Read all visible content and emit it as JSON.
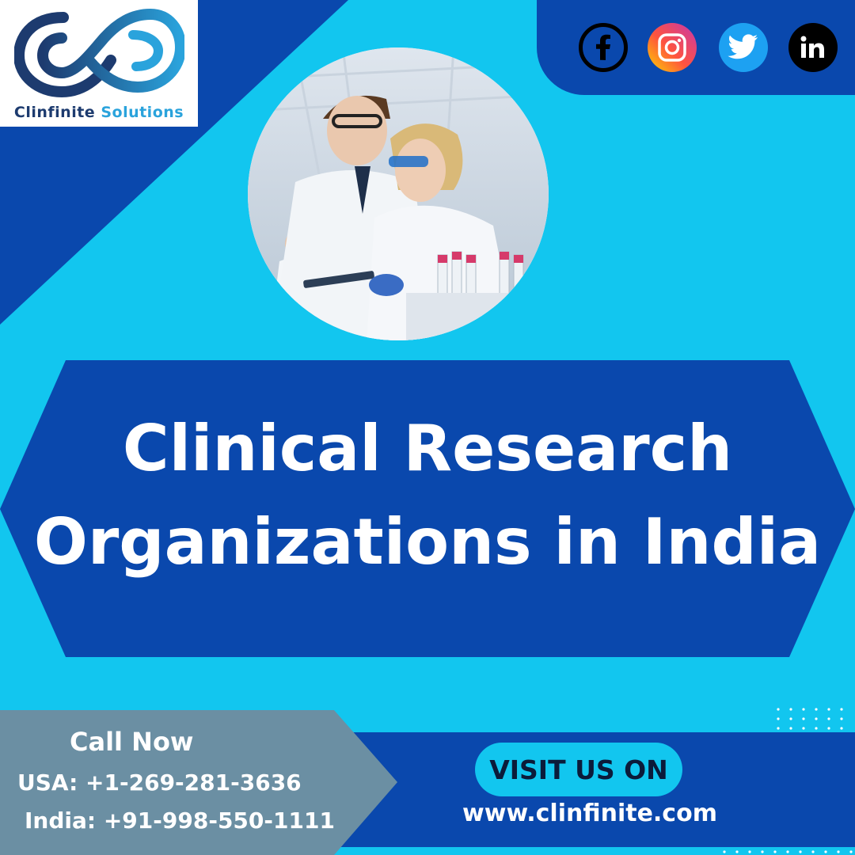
{
  "brand": {
    "name_part1": "Clinfinite",
    "name_part2": "Solutions"
  },
  "social": [
    {
      "name": "facebook",
      "icon": "facebook-icon"
    },
    {
      "name": "instagram",
      "icon": "instagram-icon"
    },
    {
      "name": "twitter",
      "icon": "twitter-icon"
    },
    {
      "name": "linkedin",
      "icon": "linkedin-icon"
    }
  ],
  "hero": {
    "title_line1": "Clinical Research",
    "title_line2": "Organizations in India"
  },
  "contact": {
    "call_label": "Call Now",
    "usa_phone": "USA: +1-269-281-3636",
    "india_phone": "India: +91-998-550-1111"
  },
  "cta": {
    "visit_label": "VISIT US ON",
    "website": "www.clinfinite.com"
  },
  "colors": {
    "light_blue": "#12c6ef",
    "dark_blue": "#0a48ad",
    "gray_panel": "#6b8fa3",
    "white": "#ffffff"
  }
}
